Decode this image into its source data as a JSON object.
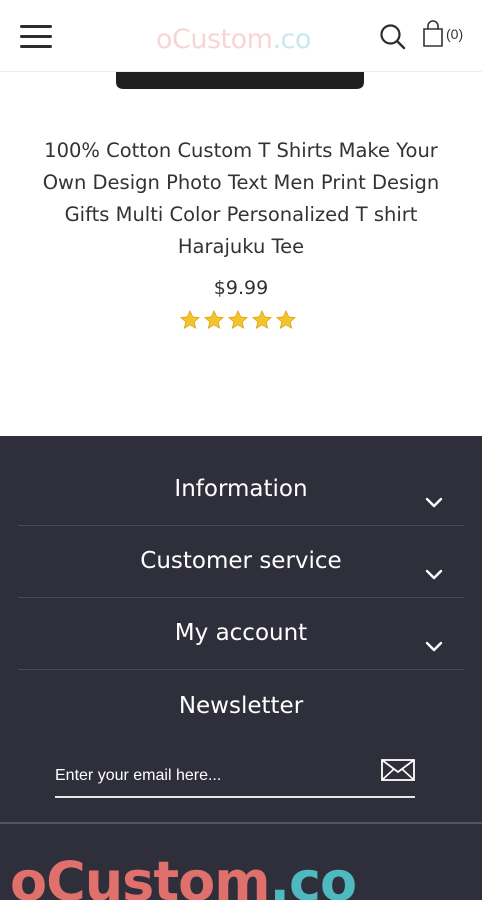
{
  "header": {
    "logo_part1": "oCustom",
    "logo_part2": ".co",
    "cart_count": "(0)",
    "icons": {
      "menu": "hamburger-menu-icon",
      "search": "search-icon",
      "cart": "shopping-bag-icon"
    }
  },
  "product": {
    "title": "100% Cotton Custom T Shirts Make Your Own Design Photo Text Men Print Design Gifts Multi Color Personalized T shirt Harajuku Tee",
    "price": "$9.99",
    "rating": 5,
    "rating_max": 5,
    "star_color": "#f4c430"
  },
  "footer": {
    "background": "#2f2f3b",
    "sections": [
      {
        "label": "Information"
      },
      {
        "label": "Customer service"
      },
      {
        "label": "My account"
      }
    ],
    "newsletter": {
      "title": "Newsletter",
      "placeholder": "Enter your email here...",
      "value": ""
    },
    "logo_part1": "oCustom",
    "logo_part2": ".co"
  }
}
